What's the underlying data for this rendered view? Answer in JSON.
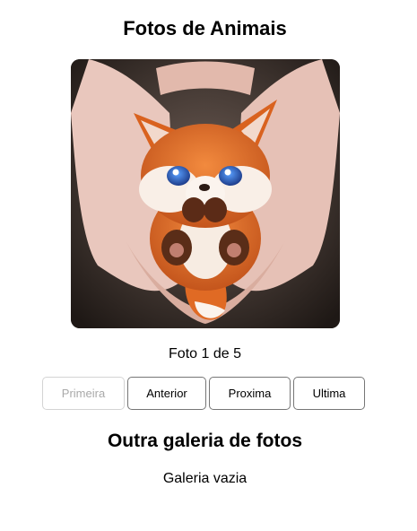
{
  "page": {
    "title": "Fotos de Animais"
  },
  "gallery": {
    "counter_text": "Foto 1 de 5",
    "current": 1,
    "total": 5,
    "buttons": {
      "first": "Primeira",
      "previous": "Anterior",
      "next": "Proxima",
      "last": "Ultima"
    },
    "first_disabled": true
  },
  "second_gallery": {
    "title": "Outra galeria de fotos",
    "empty_text": "Galeria vazia"
  }
}
